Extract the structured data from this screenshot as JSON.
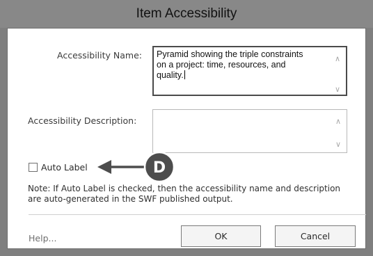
{
  "dialog": {
    "title": "Item Accessibility"
  },
  "fields": {
    "name_label": "Accessibility Name:",
    "name_value": "Pyramid showing the triple constraints\non a project: time, resources, and\nquality.",
    "description_label": "Accessibility Description:",
    "description_value": ""
  },
  "auto_label": {
    "label": "Auto Label",
    "checked": false
  },
  "note": "Note: If Auto Label is checked, then the accessibility name and description are auto-generated in the SWF published output.",
  "footer": {
    "help_label": "Help...",
    "ok_label": "OK",
    "cancel_label": "Cancel"
  },
  "callout": {
    "letter": "D"
  },
  "colors": {
    "titlebar": "#888888",
    "callout": "#4d4d4d",
    "frame": "#7f7f7f"
  }
}
